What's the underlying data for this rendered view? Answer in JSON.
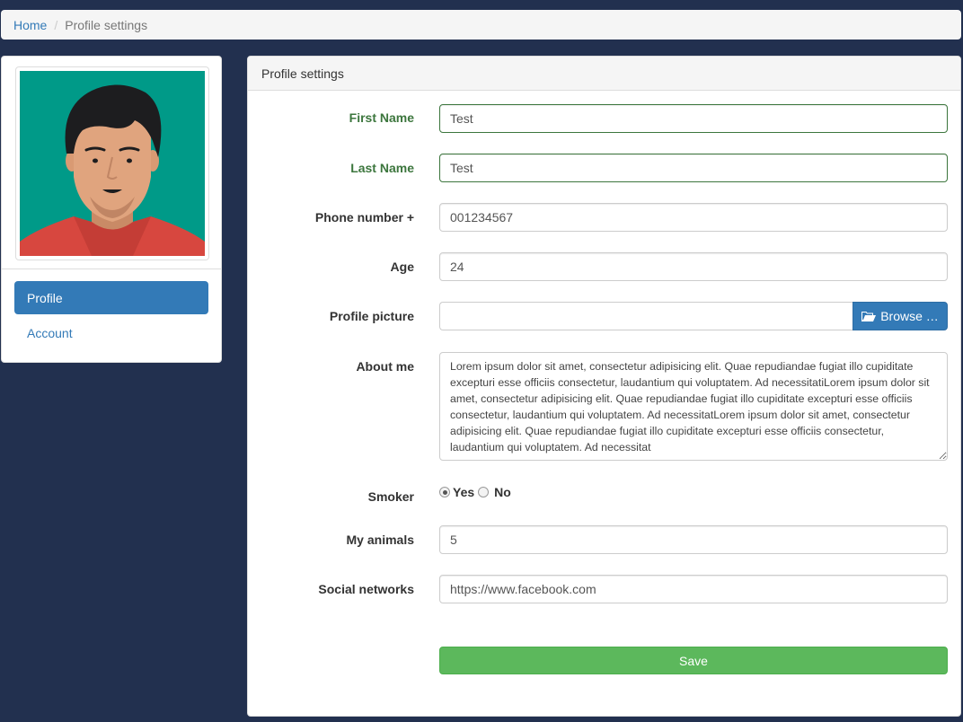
{
  "breadcrumb": {
    "home": "Home",
    "separator": "/",
    "current": "Profile settings"
  },
  "sidebar": {
    "items": [
      {
        "label": "Profile",
        "active": true
      },
      {
        "label": "Account",
        "active": false
      }
    ]
  },
  "panel": {
    "title": "Profile settings"
  },
  "form": {
    "first_name": {
      "label": "First Name",
      "value": "Test"
    },
    "last_name": {
      "label": "Last Name",
      "value": "Test"
    },
    "phone": {
      "label": "Phone number +",
      "value": "001234567"
    },
    "age": {
      "label": "Age",
      "value": "24"
    },
    "picture": {
      "label": "Profile picture",
      "value": "",
      "browse_label": "Browse …"
    },
    "about": {
      "label": "About me",
      "value": "Lorem ipsum dolor sit amet, consectetur adipisicing elit. Quae repudiandae fugiat illo cupiditate excepturi esse officiis consectetur, laudantium qui voluptatem. Ad necessitatiLorem ipsum dolor sit amet, consectetur adipisicing elit. Quae repudiandae fugiat illo cupiditate excepturi esse officiis consectetur, laudantium qui voluptatem. Ad necessitatLorem ipsum dolor sit amet, consectetur adipisicing elit. Quae repudiandae fugiat illo cupiditate excepturi esse officiis consectetur, laudantium qui voluptatem. Ad necessitat"
    },
    "smoker": {
      "label": "Smoker",
      "yes_label": "Yes",
      "no_label": "No",
      "selected": "Yes"
    },
    "animals": {
      "label": "My animals",
      "value": "5"
    },
    "social": {
      "label": "Social networks",
      "value": "https://www.facebook.com"
    },
    "save_label": "Save"
  },
  "icons": {
    "avatar": "user-avatar-illustration",
    "browse": "folder-open-icon"
  },
  "colors": {
    "page_background": "#22304f",
    "primary": "#337ab7",
    "success_text": "#3c763d",
    "save_button": "#5cb85c",
    "avatar_background": "#009a88"
  }
}
